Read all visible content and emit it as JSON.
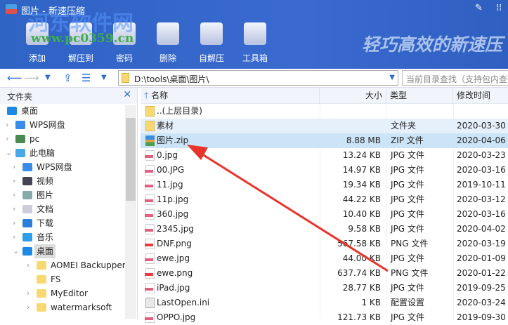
{
  "window": {
    "title": "图片 - 新速压缩",
    "watermark_logo": "河东软件网",
    "watermark_url": "www.pc0359.cn",
    "slogan": "轻巧高效的新速压"
  },
  "toolbar": [
    {
      "label": "添加",
      "icon": "add-icon"
    },
    {
      "label": "解压到",
      "icon": "extract-icon"
    },
    {
      "label": "密码",
      "icon": "lock-icon"
    },
    {
      "label": "删除",
      "icon": "trash-icon"
    },
    {
      "label": "自解压",
      "icon": "box-icon"
    },
    {
      "label": "工具箱",
      "icon": "toolbox-icon"
    }
  ],
  "address": {
    "path": "D:\\tools\\桌面\\图片\\",
    "search_placeholder": "当前目录查找（支持包内查找）"
  },
  "sidebar": {
    "title": "文件夹",
    "items": [
      {
        "label": "桌面",
        "depth": 0,
        "arrow": "",
        "color": "#1e88e5"
      },
      {
        "label": "WPS网盘",
        "depth": 0,
        "arrow": ">",
        "color": "#3b8be8"
      },
      {
        "label": "pc",
        "depth": 0,
        "arrow": ">",
        "color": "#4a8a50"
      },
      {
        "label": "此电脑",
        "depth": 0,
        "arrow": "v",
        "color": "#4aa8e8"
      },
      {
        "label": "WPS网盘",
        "depth": 1,
        "arrow": ">",
        "color": "#3b8be8"
      },
      {
        "label": "视频",
        "depth": 1,
        "arrow": ">",
        "color": "#445"
      },
      {
        "label": "图片",
        "depth": 1,
        "arrow": ">",
        "color": "#8aa"
      },
      {
        "label": "文档",
        "depth": 1,
        "arrow": ">",
        "color": "#ccd"
      },
      {
        "label": "下载",
        "depth": 1,
        "arrow": ">",
        "color": "#2b7fd8"
      },
      {
        "label": "音乐",
        "depth": 1,
        "arrow": ">",
        "color": "#2b9fe8"
      },
      {
        "label": "桌面",
        "depth": 1,
        "arrow": "v",
        "color": "#1e88e5",
        "selected": true
      },
      {
        "label": "AOMEI Backupper",
        "depth": 2,
        "arrow": ">",
        "color": "#f8d870"
      },
      {
        "label": "FS",
        "depth": 2,
        "arrow": "",
        "color": "#f8d870"
      },
      {
        "label": "MyEditor",
        "depth": 2,
        "arrow": ">",
        "color": "#f8d870"
      },
      {
        "label": "watermarksoft",
        "depth": 2,
        "arrow": ">",
        "color": "#f8d870"
      }
    ]
  },
  "columns": {
    "name": "名称",
    "size": "大小",
    "type": "类型",
    "date": "修改时间"
  },
  "files": [
    {
      "name": "..(上层目录)",
      "size": "",
      "type": "",
      "date": "",
      "kind": "fold"
    },
    {
      "name": "素材",
      "size": "",
      "type": "文件夹",
      "date": "2020-03-30",
      "kind": "fold"
    },
    {
      "name": "图片.zip",
      "size": "8.88 MB",
      "type": "ZIP 文件",
      "date": "2020-04-06",
      "kind": "zip"
    },
    {
      "name": "0.jpg",
      "size": "13.24 KB",
      "type": "JPG 文件",
      "date": "2020-03-23",
      "kind": "img"
    },
    {
      "name": "00.JPG",
      "size": "14.97 KB",
      "type": "JPG 文件",
      "date": "2020-03-16",
      "kind": "img"
    },
    {
      "name": "11.jpg",
      "size": "19.34 KB",
      "type": "JPG 文件",
      "date": "2019-10-11",
      "kind": "img"
    },
    {
      "name": "11p.jpg",
      "size": "44.22 KB",
      "type": "JPG 文件",
      "date": "2020-03-12",
      "kind": "img"
    },
    {
      "name": "360.jpg",
      "size": "10.40 KB",
      "type": "JPG 文件",
      "date": "2020-03-16",
      "kind": "img"
    },
    {
      "name": "2345.jpg",
      "size": "9.58 KB",
      "type": "JPG 文件",
      "date": "2020-04-02",
      "kind": "img"
    },
    {
      "name": "DNF.png",
      "size": "567.58 KB",
      "type": "PNG 文件",
      "date": "2020-03-19",
      "kind": "img png"
    },
    {
      "name": "ewe.jpg",
      "size": "44.00 KB",
      "type": "JPG 文件",
      "date": "2020-01-09",
      "kind": "img"
    },
    {
      "name": "ewe.png",
      "size": "637.74 KB",
      "type": "PNG 文件",
      "date": "2020-01-22",
      "kind": "img png"
    },
    {
      "name": "iPad.jpg",
      "size": "28.77 KB",
      "type": "JPG 文件",
      "date": "2019-09-25",
      "kind": "img"
    },
    {
      "name": "LastOpen.ini",
      "size": "1 KB",
      "type": "配置设置",
      "date": "2020-03-24",
      "kind": "ini"
    },
    {
      "name": "OPPO.jpg",
      "size": "121.73 KB",
      "type": "JPG 文件",
      "date": "2019-09-30",
      "kind": "img"
    }
  ],
  "colors": {
    "accent": "#2f63c4",
    "arrow": "#e8342a",
    "selected": "#cce4f7"
  }
}
